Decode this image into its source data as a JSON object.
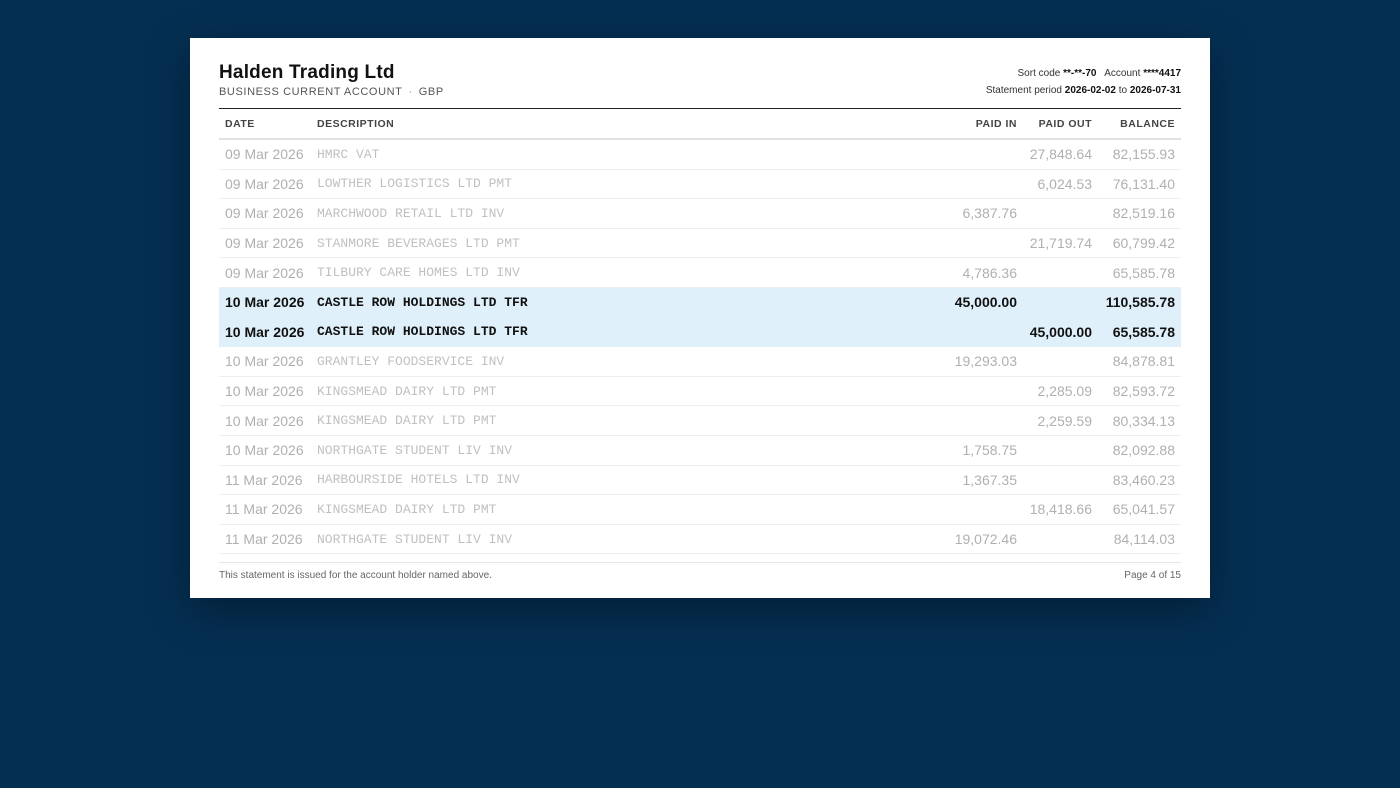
{
  "header": {
    "company": "Halden Trading Ltd",
    "account_type": "BUSINESS CURRENT ACCOUNT",
    "separator": "·",
    "currency": "GBP",
    "sort_code_label": "Sort code",
    "sort_code": "**-**-70",
    "account_label": "Account",
    "account_number": "****4417",
    "period_label": "Statement period",
    "period_start": "2026-02-02",
    "period_to": "to",
    "period_end": "2026-07-31"
  },
  "table": {
    "columns": [
      "DATE",
      "DESCRIPTION",
      "PAID IN",
      "PAID OUT",
      "BALANCE"
    ],
    "rows": [
      {
        "date": "09 Mar 2026",
        "desc": "HMRC VAT",
        "paid_in": "",
        "paid_out": "27,848.64",
        "balance": "82,155.93",
        "highlight": false
      },
      {
        "date": "09 Mar 2026",
        "desc": "LOWTHER LOGISTICS LTD PMT",
        "paid_in": "",
        "paid_out": "6,024.53",
        "balance": "76,131.40",
        "highlight": false
      },
      {
        "date": "09 Mar 2026",
        "desc": "MARCHWOOD RETAIL LTD INV",
        "paid_in": "6,387.76",
        "paid_out": "",
        "balance": "82,519.16",
        "highlight": false
      },
      {
        "date": "09 Mar 2026",
        "desc": "STANMORE BEVERAGES LTD PMT",
        "paid_in": "",
        "paid_out": "21,719.74",
        "balance": "60,799.42",
        "highlight": false
      },
      {
        "date": "09 Mar 2026",
        "desc": "TILBURY CARE HOMES LTD INV",
        "paid_in": "4,786.36",
        "paid_out": "",
        "balance": "65,585.78",
        "highlight": false
      },
      {
        "date": "10 Mar 2026",
        "desc": "CASTLE ROW HOLDINGS LTD TFR",
        "paid_in": "45,000.00",
        "paid_out": "",
        "balance": "110,585.78",
        "highlight": true
      },
      {
        "date": "10 Mar 2026",
        "desc": "CASTLE ROW HOLDINGS LTD TFR",
        "paid_in": "",
        "paid_out": "45,000.00",
        "balance": "65,585.78",
        "highlight": true
      },
      {
        "date": "10 Mar 2026",
        "desc": "GRANTLEY FOODSERVICE INV",
        "paid_in": "19,293.03",
        "paid_out": "",
        "balance": "84,878.81",
        "highlight": false
      },
      {
        "date": "10 Mar 2026",
        "desc": "KINGSMEAD DAIRY LTD PMT",
        "paid_in": "",
        "paid_out": "2,285.09",
        "balance": "82,593.72",
        "highlight": false
      },
      {
        "date": "10 Mar 2026",
        "desc": "KINGSMEAD DAIRY LTD PMT",
        "paid_in": "",
        "paid_out": "2,259.59",
        "balance": "80,334.13",
        "highlight": false
      },
      {
        "date": "10 Mar 2026",
        "desc": "NORTHGATE STUDENT LIV INV",
        "paid_in": "1,758.75",
        "paid_out": "",
        "balance": "82,092.88",
        "highlight": false
      },
      {
        "date": "11 Mar 2026",
        "desc": "HARBOURSIDE HOTELS LTD INV",
        "paid_in": "1,367.35",
        "paid_out": "",
        "balance": "83,460.23",
        "highlight": false
      },
      {
        "date": "11 Mar 2026",
        "desc": "KINGSMEAD DAIRY LTD PMT",
        "paid_in": "",
        "paid_out": "18,418.66",
        "balance": "65,041.57",
        "highlight": false
      },
      {
        "date": "11 Mar 2026",
        "desc": "NORTHGATE STUDENT LIV INV",
        "paid_in": "19,072.46",
        "paid_out": "",
        "balance": "84,114.03",
        "highlight": false
      }
    ]
  },
  "footer": {
    "note": "This statement is issued for the account holder named above.",
    "page": "Page 4 of 15"
  },
  "colors": {
    "background": "#052f52",
    "highlight_row": "#dff0fa"
  }
}
